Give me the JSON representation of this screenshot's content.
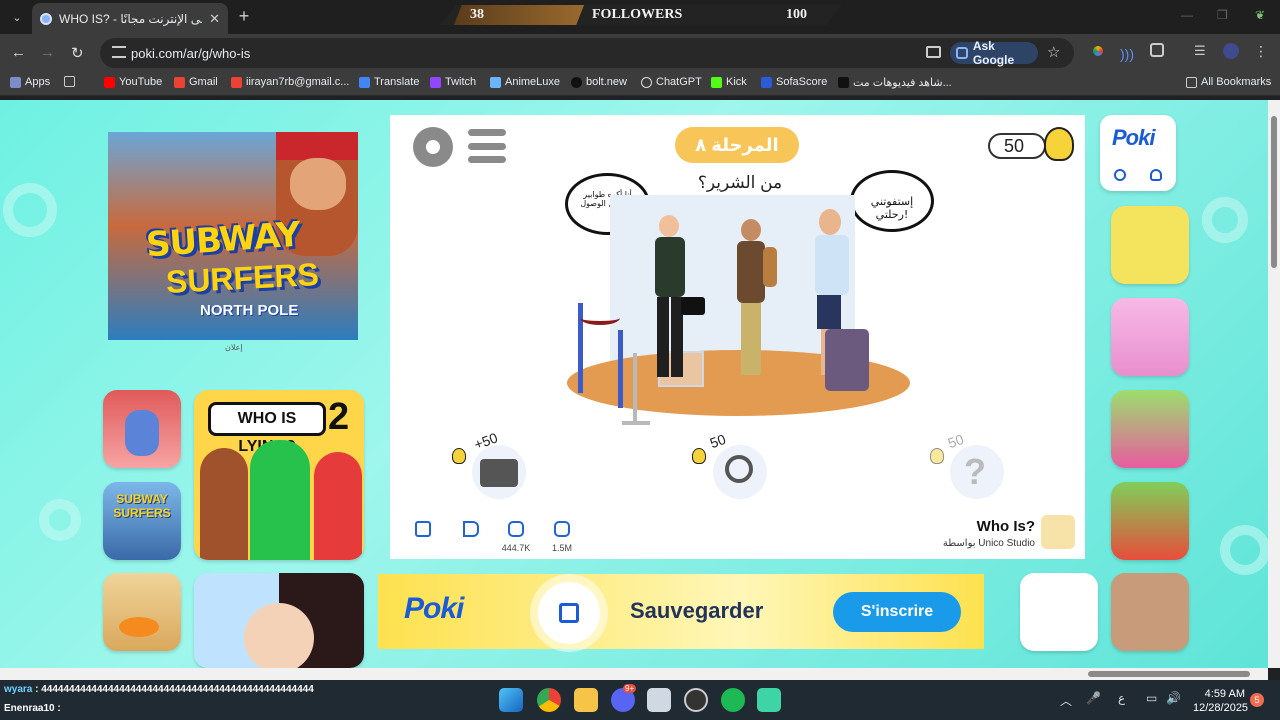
{
  "browser": {
    "tab_title": "WHO IS? - العب على الإنترنت مجانًا",
    "url": "poki.com/ar/g/who-is",
    "ask_google": "Ask Google",
    "bookmarks": [
      "Apps",
      "YouTube",
      "Gmail",
      "iirayan7rb@gmail.c...",
      "Translate",
      "Twitch",
      "AnimeLuxe",
      "bolt.new",
      "ChatGPT",
      "Kick",
      "SofaScore",
      "شاهد فيديوهات مت..."
    ],
    "all_bookmarks": "All Bookmarks"
  },
  "stream_overlay": {
    "left_value": "38",
    "label": "FOLLOWERS",
    "right_value": "100"
  },
  "ad": {
    "title_line1": "SUBWAY",
    "title_line2": "SURFERS",
    "title_line3": "NORTH POLE",
    "label": "إعلان"
  },
  "sidebar_games": {
    "who_is_lying_title": "WHO IS LYING?",
    "who_is_lying_number": "2",
    "small_game_title": "SUBWAY SURFERS"
  },
  "game": {
    "level_label": "المرحلة ٨",
    "question": "من الشرير؟",
    "hint_count": "50",
    "bubble_left": "أنا أكره طوابير تسجيل الوصول!",
    "bubble_right": "إستفوتني رحلتي!",
    "hint_costs": [
      "+50",
      "50",
      "50"
    ],
    "dislikes": "444.7K",
    "likes": "1.5M",
    "name": "Who Is?",
    "developer": "بواسطة Unico Studio"
  },
  "banner": {
    "brand": "Poki",
    "text": "Sauvegarder",
    "button": "S'inscrire"
  },
  "poki_logo": "Poki",
  "taskbar": {
    "chat_line1_user": "wyara",
    "chat_line1_text": ": 4444444444444444444444444444444444444444444444444",
    "chat_line2_user": "Enenraa10",
    "chat_line2_text": ":",
    "language": "ع",
    "time": "4:59 AM",
    "date": "12/28/2025",
    "notif_count": "5",
    "discord_badge": "9+"
  },
  "colors": {
    "page_bg": "#6ef1e2",
    "poki_blue": "#1a5bd8",
    "level_pill": "#f8c658",
    "banner_yellow": "#fde14e"
  }
}
